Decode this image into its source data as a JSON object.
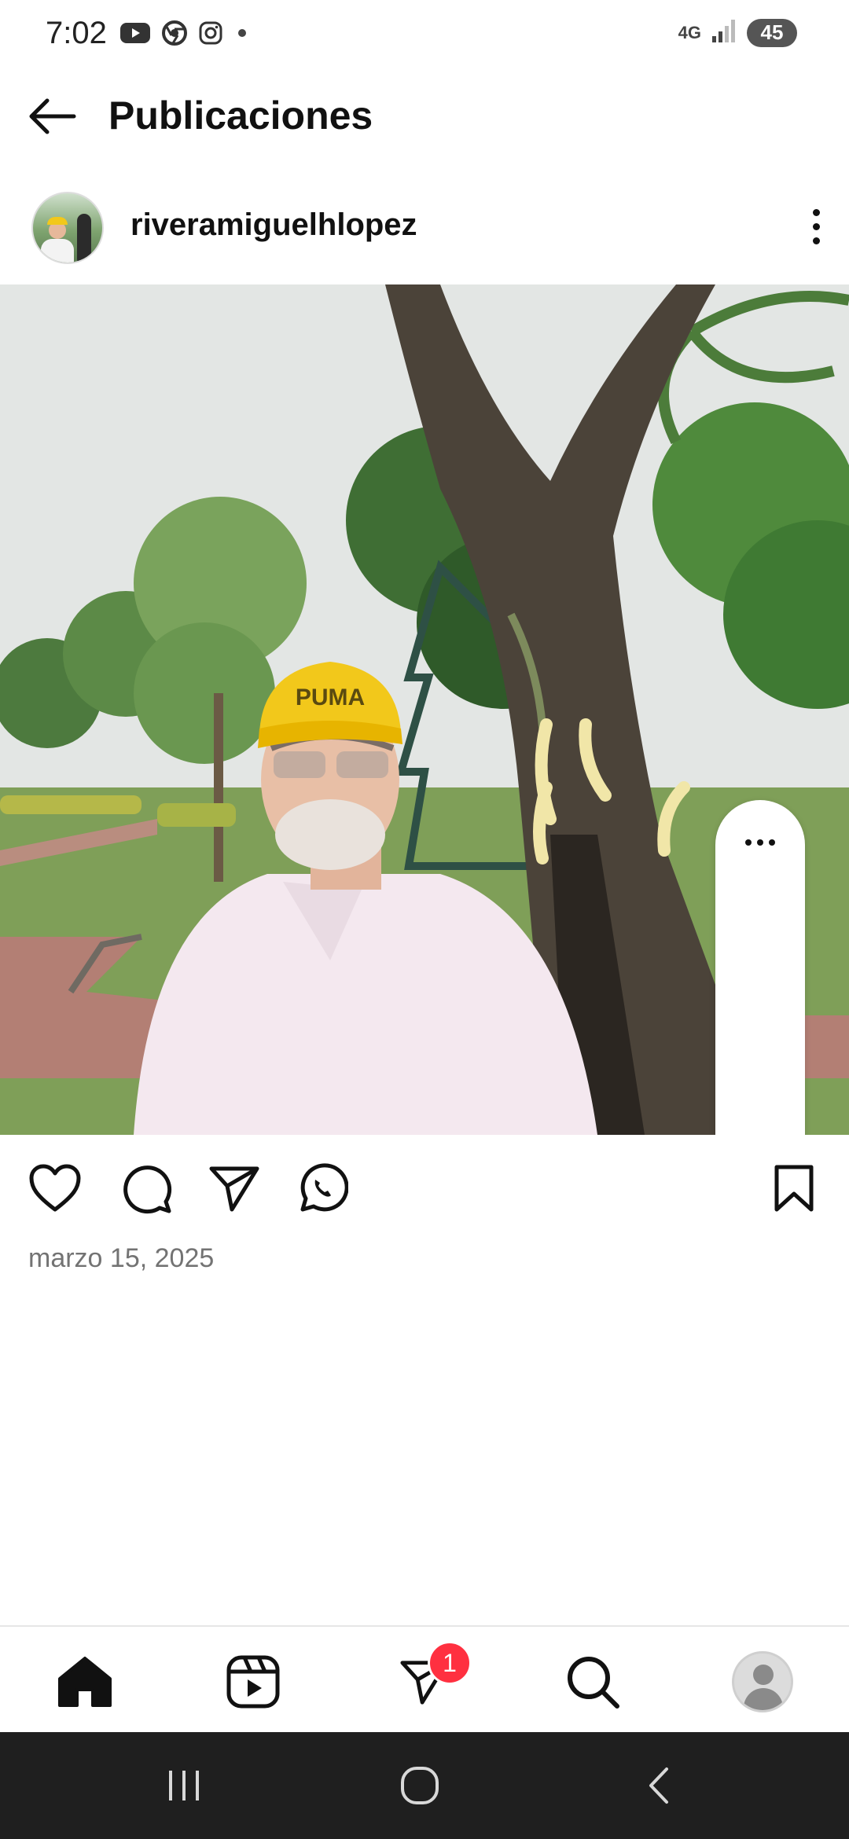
{
  "status_bar": {
    "time": "7:02",
    "network": "4G",
    "battery": "45",
    "icons_left": [
      "youtube-icon",
      "chrome-icon",
      "instagram-icon",
      "dot-icon"
    ]
  },
  "header": {
    "title": "Publicaciones"
  },
  "post": {
    "username": "riveramiguelhlopez",
    "cap_text": "PUMA",
    "date": "marzo 15, 2025"
  },
  "bottom_nav": {
    "items": [
      "home-icon",
      "reels-icon",
      "direct-icon",
      "search-icon",
      "profile-avatar"
    ],
    "direct_badge": "1"
  },
  "colors": {
    "badge": "#ff3040",
    "date_text": "#737373",
    "system_nav_bg": "#1f1f1f"
  }
}
